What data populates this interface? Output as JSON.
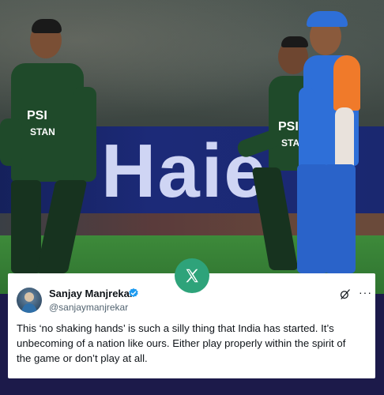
{
  "photo": {
    "ad_text": "Haie",
    "jersey_left": "PSI",
    "jersey_left_sub": "STAN",
    "jersey_mid": "PSI",
    "jersey_mid_sub": "STAN"
  },
  "icons": {
    "x_logo": "x-logo-icon",
    "verified": "verified-badge-icon",
    "grok": "grok-icon",
    "more": "more-icon"
  },
  "tweet": {
    "name": "Sanjay Manjrekar",
    "handle": "@sanjaymanjrekar",
    "more": "···",
    "lines": [
      "This ‘no shaking hands’ is such a silly thing that India has started. It’s",
      "unbecoming of a nation like ours. Either play properly within the spirit of",
      "the game or don’t play at all."
    ]
  },
  "colors": {
    "x_badge": "#2ea37a",
    "verified": "#1d9bf0",
    "pakistan_green": "#1f4a2a",
    "india_blue": "#2e6fd8"
  }
}
